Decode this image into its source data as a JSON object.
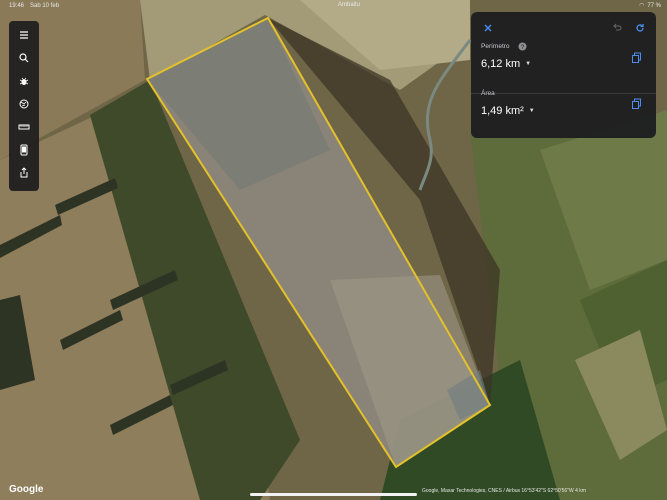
{
  "status_bar": {
    "time": "19:46",
    "date": "Sab 10 feb",
    "place": "Ambaitu",
    "battery": "77 %"
  },
  "toolbar": {
    "tools": [
      "menu-icon",
      "search-icon",
      "bug-icon",
      "globe-icon",
      "ruler-icon",
      "phone-icon",
      "share-icon"
    ]
  },
  "measure_panel": {
    "perimeter_label": "Perímetro",
    "perimeter_value": "6,12 km",
    "area_label": "Área",
    "area_value": "1,49 km²",
    "accent_color": "#4a8ef0"
  },
  "footer": {
    "logo": "Google",
    "attribution": "Google, Maxar Technologies, CNES / Airbus",
    "coords": "16°53'42\"S 62°50'56\"W",
    "scale": "4 km"
  },
  "map": {
    "outline_color": "#e4c12b"
  }
}
